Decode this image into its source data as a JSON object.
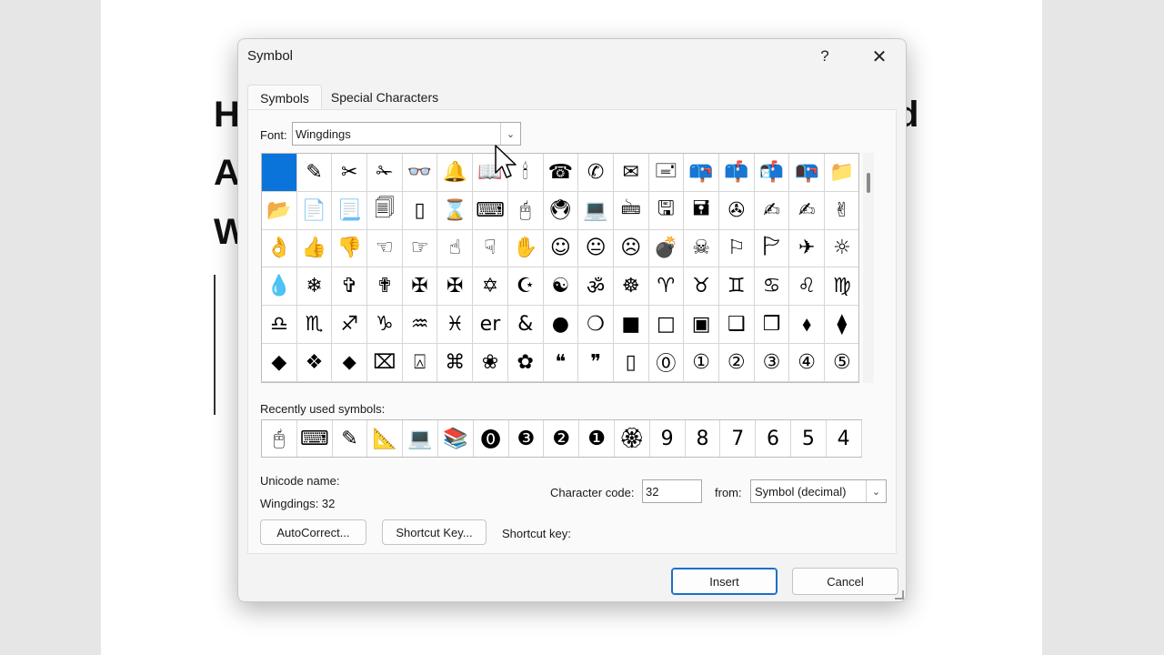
{
  "document": {
    "lines": [
      "H",
      "d",
      "A",
      "W"
    ]
  },
  "dialog": {
    "title": "Symbol",
    "help_label": "?",
    "close_label": "✕",
    "tabs": [
      "Symbols",
      "Special Characters"
    ],
    "font_label": "Font:",
    "font_value": "Wingdings",
    "symbols": [
      "",
      "✎",
      "✂",
      "✁",
      "👓",
      "🔔",
      "📖",
      "🕯",
      "☎",
      "✆",
      "✉",
      "🖃",
      "📪",
      "📫",
      "📬",
      "📭",
      "📁",
      "📂",
      "📄",
      "📃",
      "🗐",
      "▯",
      "⌛",
      "⌨",
      "🖰",
      "🖲",
      "💻",
      "🖮",
      "🖫",
      "🖬",
      "✇",
      "✍",
      "✍",
      "✌",
      "👌",
      "👍",
      "👎",
      "☜",
      "☞",
      "☝",
      "☟",
      "✋",
      "☺",
      "😐",
      "☹",
      "💣",
      "☠",
      "⚐",
      "🏱",
      "✈",
      "☼",
      "💧",
      "❄",
      "✞",
      "✟",
      "✠",
      "✠",
      "✡",
      "☪",
      "☯",
      "ॐ",
      "☸",
      "♈",
      "♉",
      "♊",
      "♋",
      "♌",
      "♍",
      "♎",
      "♏",
      "♐",
      "♑",
      "♒",
      "♓",
      "er",
      "&",
      "●",
      "❍",
      "■",
      "□",
      "▣",
      "❑",
      "❒",
      "⬧",
      "⧫",
      "◆",
      "❖",
      "⬥",
      "⌧",
      "⍓",
      "⌘",
      "❀",
      "✿",
      "❝",
      "❞",
      "▯",
      "⓪",
      "①",
      "②",
      "③",
      "④",
      "⑤"
    ],
    "recent_label": "Recently used symbols:",
    "recent_symbols": [
      "🖰",
      "⌨",
      "✎",
      "📐",
      "💻",
      "📚",
      "⓿",
      "❸",
      "❷",
      "❶",
      "🏵",
      "9",
      "8",
      "7",
      "6",
      "5",
      "4"
    ],
    "unicode_name_label": "Unicode name:",
    "unicode_name_value": "Wingdings: 32",
    "char_code_label": "Character code:",
    "char_code_value": "32",
    "from_label": "from:",
    "from_value": "Symbol (decimal)",
    "autocorrect_label": "AutoCorrect...",
    "shortcut_key_button_label": "Shortcut Key...",
    "shortcut_key_label": "Shortcut key:",
    "insert_label": "Insert",
    "cancel_label": "Cancel",
    "selected_color": "#0a74da"
  }
}
